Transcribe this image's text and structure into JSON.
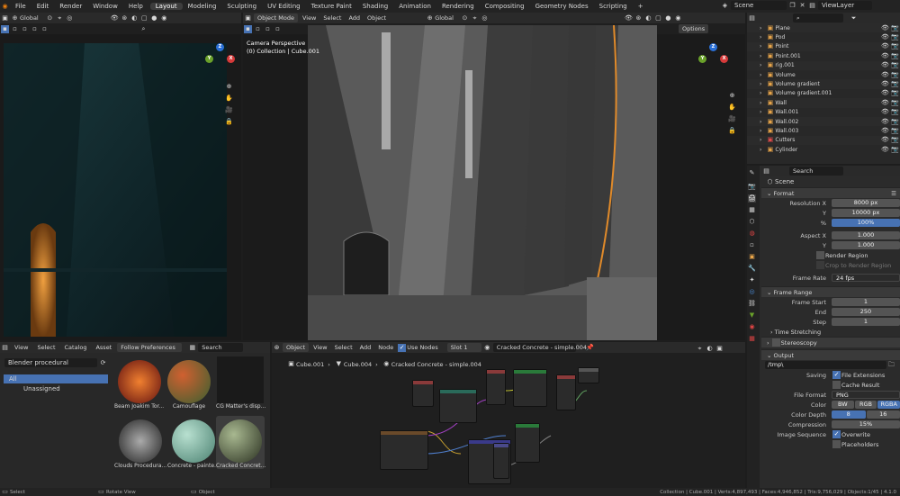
{
  "topbar": {
    "menus": [
      "File",
      "Edit",
      "Render",
      "Window",
      "Help"
    ],
    "tabs": [
      "Layout",
      "Modeling",
      "Sculpting",
      "UV Editing",
      "Texture Paint",
      "Shading",
      "Animation",
      "Rendering",
      "Compositing",
      "Geometry Nodes",
      "Scripting"
    ],
    "active_tab": "Layout",
    "scene": "Scene",
    "view_layer": "ViewLayer"
  },
  "left_viewport": {
    "orientation": "Global"
  },
  "main_viewport": {
    "mode": "Object Mode",
    "menus": [
      "View",
      "Select",
      "Add",
      "Object"
    ],
    "orientation": "Global",
    "options": "Options",
    "info_line1": "Camera Perspective",
    "info_line2": "(0) Collection | Cube.001"
  },
  "outliner": {
    "items": [
      {
        "label": "Plane",
        "color": "#e8a54a"
      },
      {
        "label": "Pod",
        "color": "#e8a54a"
      },
      {
        "label": "Point",
        "color": "#e8a54a"
      },
      {
        "label": "Point.001",
        "color": "#e8a54a"
      },
      {
        "label": "rig.001",
        "color": "#e8a54a"
      },
      {
        "label": "Volume",
        "color": "#e8a54a"
      },
      {
        "label": "Volume gradient",
        "color": "#e8a54a"
      },
      {
        "label": "Volume gradient.001",
        "color": "#e8a54a"
      },
      {
        "label": "Wall",
        "color": "#e8a54a"
      },
      {
        "label": "Wall.001",
        "color": "#e8a54a"
      },
      {
        "label": "Wall.002",
        "color": "#e8a54a"
      },
      {
        "label": "Wall.003",
        "color": "#e8a54a"
      },
      {
        "label": "Cutters",
        "color": "#e04a4a"
      },
      {
        "label": "Cylinder",
        "color": "#e8a54a"
      }
    ]
  },
  "properties": {
    "search_placeholder": "Search",
    "scene_label": "Scene",
    "format": {
      "title": "Format",
      "resolution_x_label": "Resolution X",
      "resolution_x": "8000 px",
      "y_label": "Y",
      "resolution_y": "10000 px",
      "pct_label": "%",
      "pct": "100%",
      "aspect_x_label": "Aspect X",
      "aspect_x": "1.000",
      "aspect_y_label": "Y",
      "aspect_y": "1.000",
      "render_region": "Render Region",
      "crop": "Crop to Render Region",
      "frame_rate_label": "Frame Rate",
      "frame_rate": "24 fps"
    },
    "frame_range": {
      "title": "Frame Range",
      "start_label": "Frame Start",
      "start": "1",
      "end_label": "End",
      "end": "250",
      "step_label": "Step",
      "step": "1",
      "time_stretching": "Time Stretching",
      "stereoscopy": "Stereoscopy"
    },
    "output": {
      "title": "Output",
      "path": "/tmp\\",
      "saving_label": "Saving",
      "file_ext": "File Extensions",
      "cache": "Cache Result",
      "file_format_label": "File Format",
      "file_format": "PNG",
      "color_label": "Color",
      "color_opts": [
        "BW",
        "RGB",
        "RGBA"
      ],
      "color_depth_label": "Color Depth",
      "depth_opts": [
        "8",
        "16"
      ],
      "compression_label": "Compression",
      "compression": "15%",
      "image_seq_label": "Image Sequence",
      "overwrite": "Overwrite",
      "placeholders": "Placeholders"
    }
  },
  "asset_browser": {
    "menus": [
      "View",
      "Select",
      "Catalog",
      "Asset"
    ],
    "follow": "Follow Preferences",
    "search_placeholder": "Search",
    "library": "Blender procedural",
    "catalogs": [
      "All",
      "Unassigned"
    ],
    "assets": [
      "Beam Joakim Tor...",
      "Camouflage",
      "CG Matter's disp...",
      "Clouds Procedura...",
      "Concrete - painte...",
      "Cracked Concret..."
    ]
  },
  "node_editor": {
    "object": "Object",
    "menus": [
      "View",
      "Select",
      "Add",
      "Node"
    ],
    "use_nodes": "Use Nodes",
    "slot": "Slot 1",
    "material": "Cracked Concrete - simple.004",
    "breadcrumb": [
      "Cube.001",
      "Cube.004",
      "Cracked Concrete - simple.004"
    ]
  },
  "statusbar": {
    "left": "Select",
    "middle": "Rotate View",
    "right_label": "Object",
    "stats": "Collection | Cube.001 | Verts:4,897,493 | Faces:4,946,852 | Tris:9,756,029 | Objects:1/45 | 4.1.0"
  }
}
